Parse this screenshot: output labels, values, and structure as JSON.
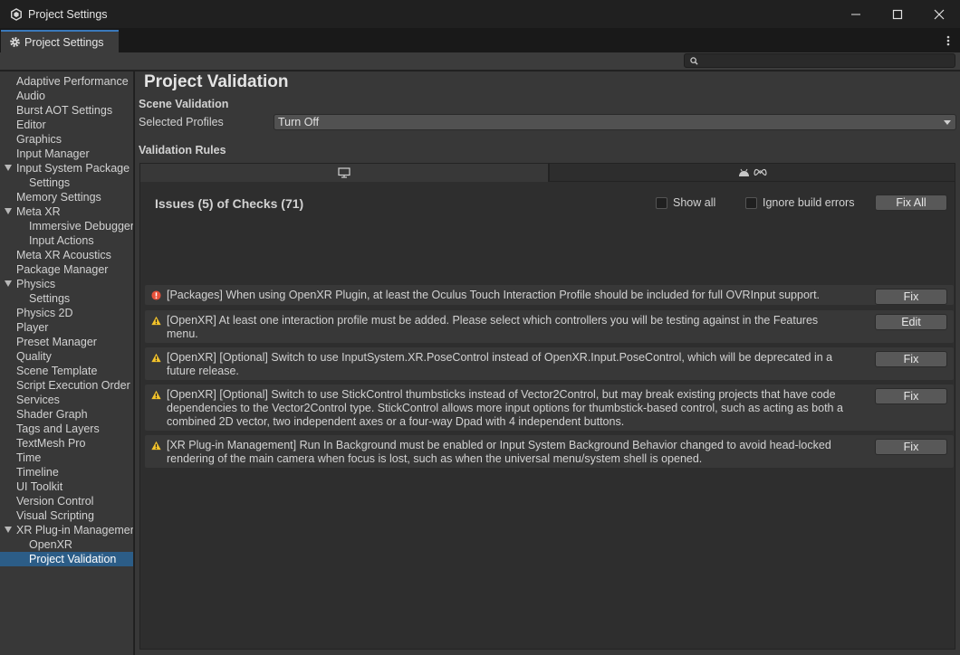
{
  "window": {
    "title": "Project Settings",
    "controls": [
      "minimize",
      "maximize",
      "close"
    ]
  },
  "tab": {
    "label": "Project Settings"
  },
  "search": {
    "placeholder": ""
  },
  "sidebar": {
    "items": [
      {
        "label": "Adaptive Performance",
        "indent": 0,
        "caret": false,
        "selected": false
      },
      {
        "label": "Audio",
        "indent": 0,
        "caret": false,
        "selected": false
      },
      {
        "label": "Burst AOT Settings",
        "indent": 0,
        "caret": false,
        "selected": false
      },
      {
        "label": "Editor",
        "indent": 0,
        "caret": false,
        "selected": false
      },
      {
        "label": "Graphics",
        "indent": 0,
        "caret": false,
        "selected": false
      },
      {
        "label": "Input Manager",
        "indent": 0,
        "caret": false,
        "selected": false
      },
      {
        "label": "Input System Package",
        "indent": 0,
        "caret": true,
        "selected": false
      },
      {
        "label": "Settings",
        "indent": 1,
        "caret": false,
        "selected": false
      },
      {
        "label": "Memory Settings",
        "indent": 0,
        "caret": false,
        "selected": false
      },
      {
        "label": "Meta XR",
        "indent": 0,
        "caret": true,
        "selected": false
      },
      {
        "label": "Immersive Debugger",
        "indent": 1,
        "caret": false,
        "selected": false
      },
      {
        "label": "Input Actions",
        "indent": 1,
        "caret": false,
        "selected": false
      },
      {
        "label": "Meta XR Acoustics",
        "indent": 0,
        "caret": false,
        "selected": false
      },
      {
        "label": "Package Manager",
        "indent": 0,
        "caret": false,
        "selected": false
      },
      {
        "label": "Physics",
        "indent": 0,
        "caret": true,
        "selected": false
      },
      {
        "label": "Settings",
        "indent": 1,
        "caret": false,
        "selected": false
      },
      {
        "label": "Physics 2D",
        "indent": 0,
        "caret": false,
        "selected": false
      },
      {
        "label": "Player",
        "indent": 0,
        "caret": false,
        "selected": false
      },
      {
        "label": "Preset Manager",
        "indent": 0,
        "caret": false,
        "selected": false
      },
      {
        "label": "Quality",
        "indent": 0,
        "caret": false,
        "selected": false
      },
      {
        "label": "Scene Template",
        "indent": 0,
        "caret": false,
        "selected": false
      },
      {
        "label": "Script Execution Order",
        "indent": 0,
        "caret": false,
        "selected": false
      },
      {
        "label": "Services",
        "indent": 0,
        "caret": false,
        "selected": false
      },
      {
        "label": "Shader Graph",
        "indent": 0,
        "caret": false,
        "selected": false
      },
      {
        "label": "Tags and Layers",
        "indent": 0,
        "caret": false,
        "selected": false
      },
      {
        "label": "TextMesh Pro",
        "indent": 0,
        "caret": false,
        "selected": false
      },
      {
        "label": "Time",
        "indent": 0,
        "caret": false,
        "selected": false
      },
      {
        "label": "Timeline",
        "indent": 0,
        "caret": false,
        "selected": false
      },
      {
        "label": "UI Toolkit",
        "indent": 0,
        "caret": false,
        "selected": false
      },
      {
        "label": "Version Control",
        "indent": 0,
        "caret": false,
        "selected": false
      },
      {
        "label": "Visual Scripting",
        "indent": 0,
        "caret": false,
        "selected": false
      },
      {
        "label": "XR Plug-in Management",
        "indent": 0,
        "caret": true,
        "selected": false
      },
      {
        "label": "OpenXR",
        "indent": 1,
        "caret": false,
        "selected": false
      },
      {
        "label": "Project Validation",
        "indent": 1,
        "caret": false,
        "selected": true
      }
    ]
  },
  "main": {
    "title": "Project Validation",
    "scene_validation": {
      "heading": "Scene Validation",
      "field_label": "Selected Profiles",
      "field_value": "Turn Off"
    },
    "validation_rules": {
      "heading": "Validation Rules",
      "platform_tabs": [
        {
          "icon": "monitor-icon",
          "active": true
        },
        {
          "icon": "android-meta-icon",
          "active": false
        }
      ],
      "issues_header": "Issues (5) of Checks (71)",
      "show_all_label": "Show all",
      "show_all_checked": false,
      "ignore_build_errors_label": "Ignore build errors",
      "ignore_build_errors_checked": false,
      "fix_all_label": "Fix All",
      "issues": [
        {
          "severity": "error",
          "text": "[Packages] When using OpenXR Plugin, at least the Oculus Touch Interaction Profile should be included for full OVRInput support.",
          "action": "Fix"
        },
        {
          "severity": "warning",
          "text": "[OpenXR] At least one interaction profile must be added.  Please select which controllers you will be testing against in the Features menu.",
          "action": "Edit"
        },
        {
          "severity": "warning",
          "text": "[OpenXR] [Optional] Switch to use InputSystem.XR.PoseControl instead of OpenXR.Input.PoseControl, which will be deprecated in a future release.",
          "action": "Fix"
        },
        {
          "severity": "warning",
          "text": "[OpenXR] [Optional] Switch to use StickControl thumbsticks instead of Vector2Control, but may break existing projects that have code dependencies to the Vector2Control type. StickControl allows more input options for thumbstick-based control, such as acting as both a combined 2D vector, two independent axes or a four-way Dpad with 4 independent buttons.",
          "action": "Fix"
        },
        {
          "severity": "warning",
          "text": "[XR Plug-in Management] Run In Background must be enabled or Input System Background Behavior changed to avoid head-locked rendering of the main camera when focus is lost, such as when the universal menu/system shell is opened.",
          "action": "Fix"
        }
      ]
    }
  },
  "colors": {
    "selection": "#2c5d87",
    "tab_accent": "#3a79bb",
    "error": "#e8513a",
    "warning": "#f4c42b"
  }
}
